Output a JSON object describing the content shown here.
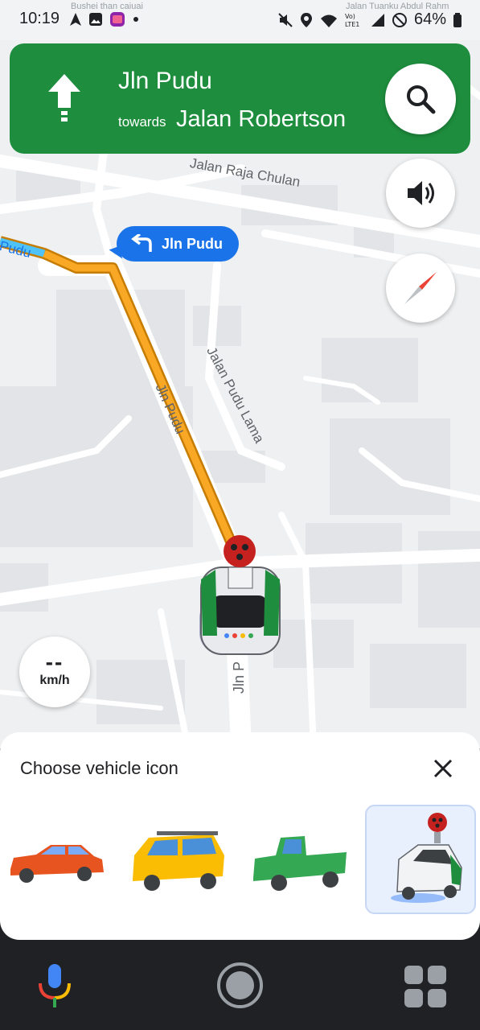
{
  "status_bar": {
    "time": "10:19",
    "battery_percent": "64%",
    "icons": [
      "navigation-arrow-icon",
      "gallery-icon",
      "app-badge-icon",
      "dot-icon",
      "mute-icon",
      "location-icon",
      "wifi-icon",
      "volte-icon",
      "signal-icon",
      "dnd-icon",
      "battery-icon"
    ],
    "volte_label": "Vo) LTE1"
  },
  "map": {
    "streets": [
      "Jalan Raja Chulan",
      "Jalan Pudu Lama",
      "Jln Pudu",
      "Pudu",
      "Jln P"
    ],
    "faint_text": [
      "Bushei than caiuai",
      "Jalan Tuanku Abdul Rahm"
    ]
  },
  "navigation": {
    "street": "Jln Pudu",
    "towards_label": "towards",
    "towards_street": "Jalan Robertson",
    "direction_icon": "straight-arrow-icon"
  },
  "turn_chip": {
    "label": "Jln Pudu",
    "icon": "turn-left-icon"
  },
  "speed": {
    "value": "--",
    "unit": "km/h"
  },
  "vehicle_sheet": {
    "title": "Choose vehicle icon",
    "options": [
      {
        "name": "red-sedan",
        "selected": false
      },
      {
        "name": "yellow-suv",
        "selected": false
      },
      {
        "name": "green-pickup",
        "selected": false
      },
      {
        "name": "street-view-car",
        "selected": true
      }
    ]
  },
  "colors": {
    "banner_green": "#1e8e3e",
    "route_orange": "#f9a825",
    "chip_blue": "#1a73e8"
  }
}
